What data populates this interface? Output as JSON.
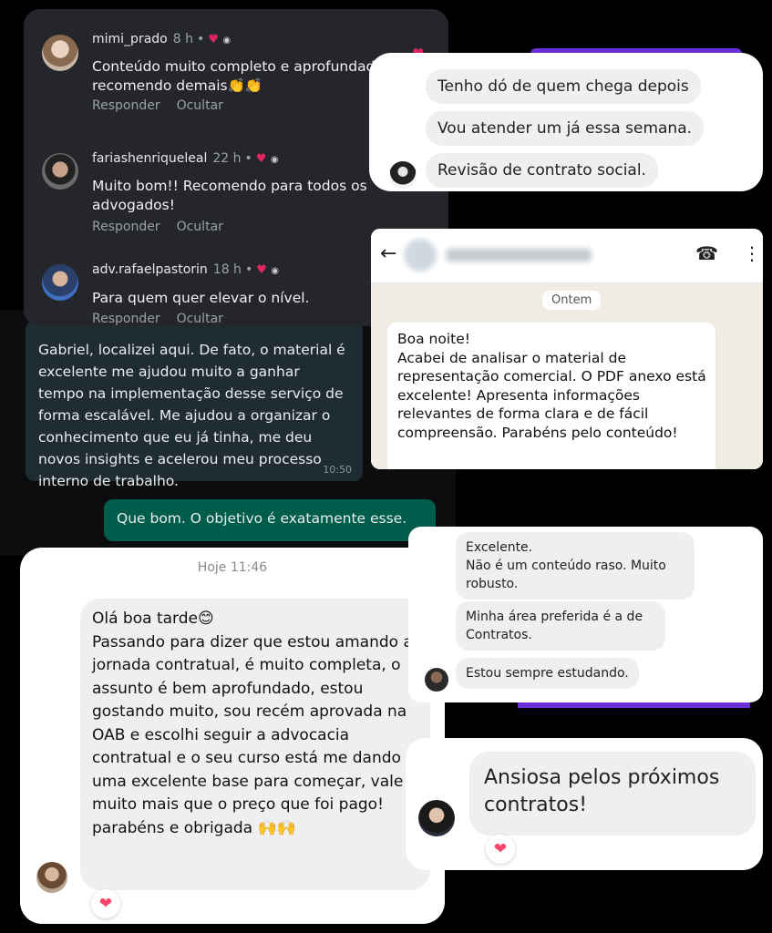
{
  "instagram_comments": [
    {
      "user": "mimi_prado",
      "time": "8 h",
      "text": "Conteúdo muito completo e aprofundado, recomendo demais👏👏",
      "reply": "Responder",
      "hide": "Ocultar"
    },
    {
      "user": "fariashenriqueleal",
      "time": "22 h",
      "text": "Muito bom!! Recomendo para todos os advogados!",
      "reply": "Responder",
      "hide": "Ocultar"
    },
    {
      "user": "adv.rafaelpastorin",
      "time": "18 h",
      "text": "Para quem quer elevar o nível.",
      "reply": "Responder",
      "hide": "Ocultar"
    }
  ],
  "wa_dark": {
    "message": "Gabriel, localizei aqui. De fato, o material é excelente me ajudou muito a ganhar tempo na implementação desse serviço de forma escalável. Me ajudou a organizar o conhecimento que eu já tinha, me deu novos insights e acelerou meu processo interno de trabalho.",
    "time": "10:50",
    "reply": "Que bom. O objetivo é exatamente esse."
  },
  "chat_top_right": {
    "messages": [
      "Tenho dó de quem chega depois",
      "Vou atender um já essa semana.",
      "Revisão de contrato social."
    ]
  },
  "wa_light": {
    "date": "Ontem",
    "message": "Boa noite!\nAcabei de analisar o material de representação comercial. O PDF anexo está excelente! Apresenta informações relevantes de forma clara e de fácil compreensão. Parabéns pelo conteúdo!"
  },
  "chat_bottom_left": {
    "time": "Hoje 11:46",
    "message": "Olá boa tarde😊\nPassando para dizer que estou amando a jornada contratual, é muito completa, o assunto é bem aprofundado, estou gostando muito, sou recém aprovada na OAB e escolhi seguir a advocacia contratual e o seu curso está me dando uma excelente base para começar, vale muito mais que o preço que foi pago! parabéns e obrigada 🙌🙌",
    "reaction": "❤️"
  },
  "chat_right_middle": {
    "messages": [
      "Excelente.\nNão é um conteúdo raso. Muito robusto.",
      "Minha área preferida é a de Contratos.",
      "Estou sempre estudando."
    ]
  },
  "chat_bottom_right": {
    "message": "Ansiosa pelos próximos contratos!",
    "reaction": "❤️"
  },
  "icons": {
    "heart": "♥",
    "back_arrow": "←",
    "call_add": "☎",
    "menu": "⋮"
  }
}
